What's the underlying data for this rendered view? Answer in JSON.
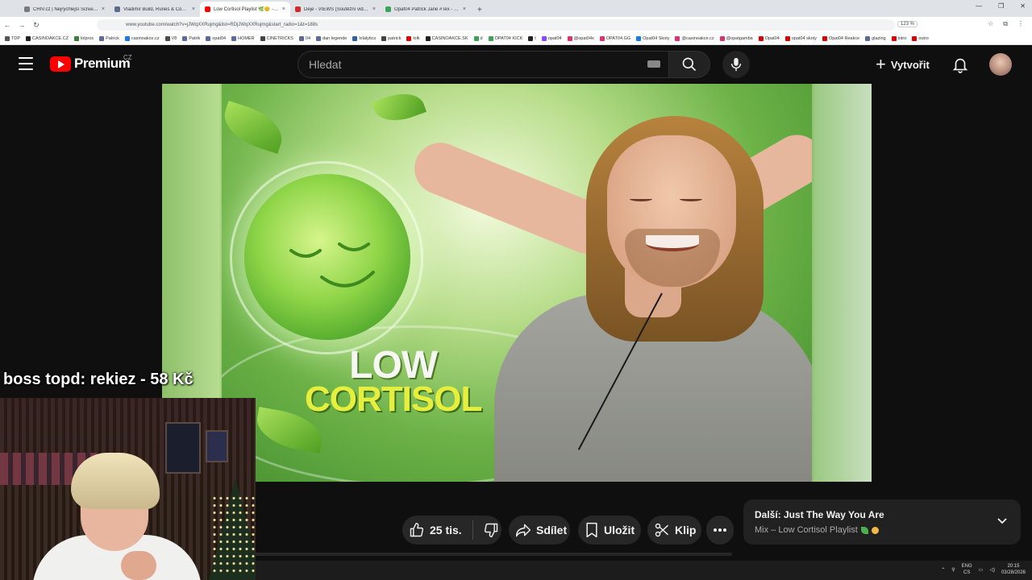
{
  "browser": {
    "tabs": [
      {
        "title": "CHIV.cz | Nejrychlejší ScreenSh",
        "color": "#7a7a7a",
        "active": false
      },
      {
        "title": "Vladimir Build, Runes & Counter",
        "color": "#5b6b8c",
        "active": false
      },
      {
        "title": "Low Cortisol Playlist 🌿😊 - Yo",
        "color": "#ff0000",
        "active": true
      },
      {
        "title": "Deje - VIEWS (Soutěžní videoklip",
        "color": "#d12b2b",
        "active": false
      },
      {
        "title": "Opat04 Patrick Jane #Tex - LOL",
        "color": "#3aa35a",
        "active": false
      }
    ],
    "new_tab": "+",
    "url": "www.youtube.com/watch?v=jJWqXXRujmg&list=RDjJWqXXRujmg&start_radio=1&t=188s",
    "zoom": "123 %",
    "bookmarks": [
      {
        "label": "TDP",
        "color": "#555"
      },
      {
        "label": "CASINOAKCE.CZ",
        "color": "#222"
      },
      {
        "label": "lolpros",
        "color": "#3b7d3b"
      },
      {
        "label": "Patrick",
        "color": "#5a6a9a"
      },
      {
        "label": "casinoakce.cz",
        "color": "#1877f2"
      },
      {
        "label": "V8",
        "color": "#4a4a4a"
      },
      {
        "label": "Patrik",
        "color": "#5a6a9a"
      },
      {
        "label": "opat04",
        "color": "#5a6a9a"
      },
      {
        "label": "HOMER",
        "color": "#5a6a9a"
      },
      {
        "label": "CINETRICKS",
        "color": "#444"
      },
      {
        "label": "04",
        "color": "#5a6a9a"
      },
      {
        "label": "dan legende",
        "color": "#5a6a9a"
      },
      {
        "label": "lolalytics",
        "color": "#2b5fa8"
      },
      {
        "label": "patrick",
        "color": "#444"
      },
      {
        "label": "lolk",
        "color": "#d00"
      },
      {
        "label": "CASINOAKCE.SK",
        "color": "#222"
      },
      {
        "label": "d",
        "color": "#3aa35a"
      },
      {
        "label": "OPAT04 KICK",
        "color": "#3aa35a"
      },
      {
        "label": "t",
        "color": "#222"
      },
      {
        "label": "opat04",
        "color": "#9146ff"
      },
      {
        "label": "@opat04x",
        "color": "#e1306c"
      },
      {
        "label": "OPAT04.GG",
        "color": "#e1306c"
      },
      {
        "label": "Opat04 Skoty",
        "color": "#1877f2"
      },
      {
        "label": "@casinoakce.cz",
        "color": "#e1306c"
      },
      {
        "label": "@opatgamba",
        "color": "#e1306c"
      },
      {
        "label": "Opat04",
        "color": "#d00"
      },
      {
        "label": "opat04 skoty",
        "color": "#d00"
      },
      {
        "label": "Opat04 Reakce",
        "color": "#d00"
      },
      {
        "label": "glazing",
        "color": "#5a6a9a"
      },
      {
        "label": "intro",
        "color": "#d00"
      },
      {
        "label": "outro",
        "color": "#d00"
      }
    ]
  },
  "header": {
    "logo_text": "Premium",
    "country": "CZ",
    "search_placeholder": "Hledat",
    "create_label": "Vytvořit"
  },
  "thumbnail": {
    "line1": "LOW",
    "line2": "CORTISOL"
  },
  "overlay": {
    "donation_user": "boss topd:",
    "donation_msg": "rekiez -",
    "donation_amount": "58 Kč"
  },
  "actions": {
    "like_count": "25 tis.",
    "share_label": "Sdílet",
    "save_label": "Uložit",
    "clip_label": "Klip"
  },
  "next_up": {
    "title": "Další: Just The Way You Are",
    "subtitle": "Mix – Low Cortisol Playlist"
  },
  "taskbar": {
    "lang_top": "ENG",
    "lang_bottom": "CS",
    "time": "20:15",
    "date": "03/28/2026"
  }
}
